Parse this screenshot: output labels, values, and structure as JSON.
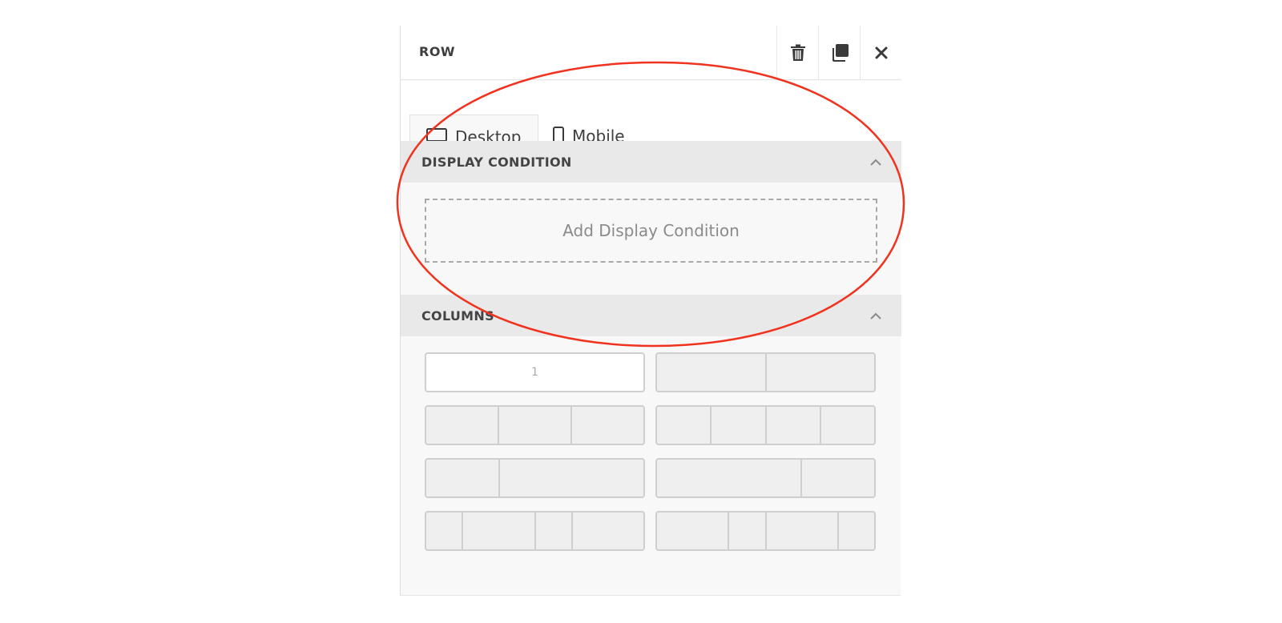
{
  "panel": {
    "title": "ROW",
    "actions": [
      {
        "name": "delete",
        "icon": "trash-icon"
      },
      {
        "name": "duplicate",
        "icon": "duplicate-icon"
      },
      {
        "name": "close",
        "icon": "close-icon"
      }
    ]
  },
  "tabs": [
    {
      "label": "Desktop",
      "icon": "monitor-icon",
      "active": true
    },
    {
      "label": "Mobile",
      "icon": "mobile-phone-icon",
      "active": false
    }
  ],
  "display_condition": {
    "title": "DISPLAY CONDITION",
    "add_label": "Add Display Condition"
  },
  "columns": {
    "title": "COLUMNS",
    "layouts": [
      {
        "label": "1",
        "selected": true,
        "cells": [
          1
        ]
      },
      {
        "selected": false,
        "cells": [
          1,
          1
        ]
      },
      {
        "selected": false,
        "cells": [
          1,
          1,
          1
        ]
      },
      {
        "selected": false,
        "cells": [
          1,
          1,
          1,
          1
        ]
      },
      {
        "selected": false,
        "cells": [
          1,
          2
        ]
      },
      {
        "selected": false,
        "cells": [
          2,
          1
        ]
      },
      {
        "selected": false,
        "cells": [
          1,
          2,
          1,
          2
        ]
      },
      {
        "selected": false,
        "cells": [
          2,
          1,
          2,
          1
        ]
      }
    ]
  },
  "colors": {
    "annotation": "#f0321e",
    "section_header_bg": "#e9e9e9",
    "panel_bg": "#f8f8f8"
  }
}
